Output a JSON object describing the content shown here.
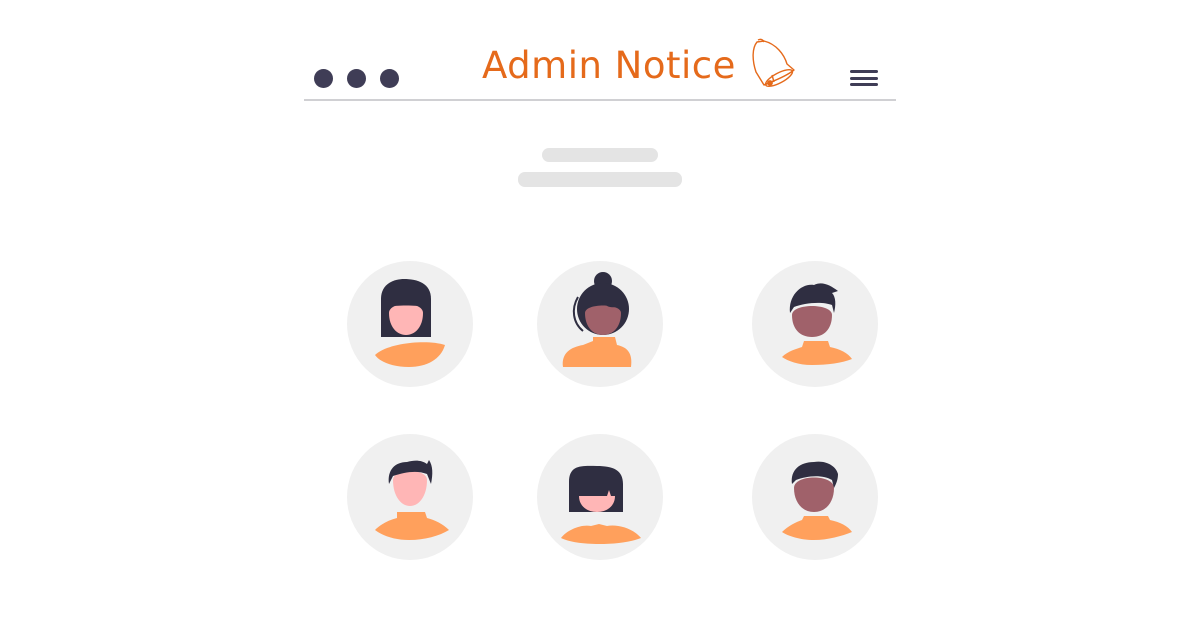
{
  "header": {
    "title": "Admin Notice",
    "window_dots": [
      "dot-1",
      "dot-2",
      "dot-3"
    ],
    "icons": {
      "bell": "bell-icon",
      "menu": "hamburger-menu-icon"
    }
  },
  "placeholder_lines": 2,
  "colors": {
    "accent": "#e56a1b",
    "dark": "#3f3d56",
    "hair": "#2f2e41",
    "circle_bg": "#f0f0f0",
    "shirt": "#ffa05c",
    "skin_light": "#ffb6b6",
    "skin_dark": "#a0616a",
    "skeleton": "#e4e4e4",
    "divider": "#d0d0d3"
  },
  "avatars": [
    {
      "id": "user-1",
      "style": "bob-hair",
      "skin": "light"
    },
    {
      "id": "user-2",
      "style": "bun-hair",
      "skin": "dark"
    },
    {
      "id": "user-3",
      "style": "spiky-hair",
      "skin": "dark"
    },
    {
      "id": "user-4",
      "style": "short-hair",
      "skin": "light"
    },
    {
      "id": "user-5",
      "style": "long-bangs-hair",
      "skin": "light"
    },
    {
      "id": "user-6",
      "style": "short-hair",
      "skin": "dark"
    }
  ]
}
